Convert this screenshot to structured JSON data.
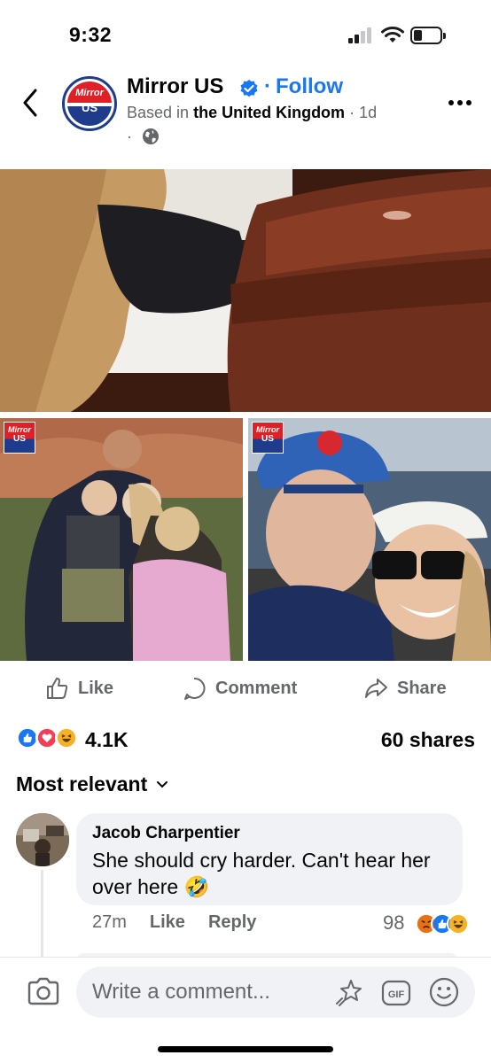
{
  "status_bar": {
    "time": "9:32"
  },
  "header": {
    "page_name": "Mirror US",
    "follow_separator": "·",
    "follow_label": "Follow",
    "based_in_prefix": "Based in",
    "based_in_location": "the United Kingdom",
    "age": "· 1d",
    "privacy_dot": "·",
    "avatar_text": "Mirror",
    "avatar_sub": "US"
  },
  "photos": {
    "badge_text": "Mirror",
    "badge_sub": "US"
  },
  "actions": {
    "like_label": "Like",
    "comment_label": "Comment",
    "share_label": "Share"
  },
  "stats": {
    "reaction_count": "4.1K",
    "shares": "60 shares"
  },
  "comments_filter": {
    "label": "Most relevant"
  },
  "comment": {
    "author": "Jacob Charpentier",
    "text": "She should cry harder. Can't hear her over here 🤣",
    "time": "27m",
    "like_label": "Like",
    "reply_label": "Reply",
    "reaction_count": "98"
  },
  "composer": {
    "placeholder": "Write a comment...",
    "gif_label": "GIF"
  },
  "colors": {
    "accent": "#1877f2",
    "secondary_text": "#65676b",
    "bubble": "#f0f2f5"
  }
}
